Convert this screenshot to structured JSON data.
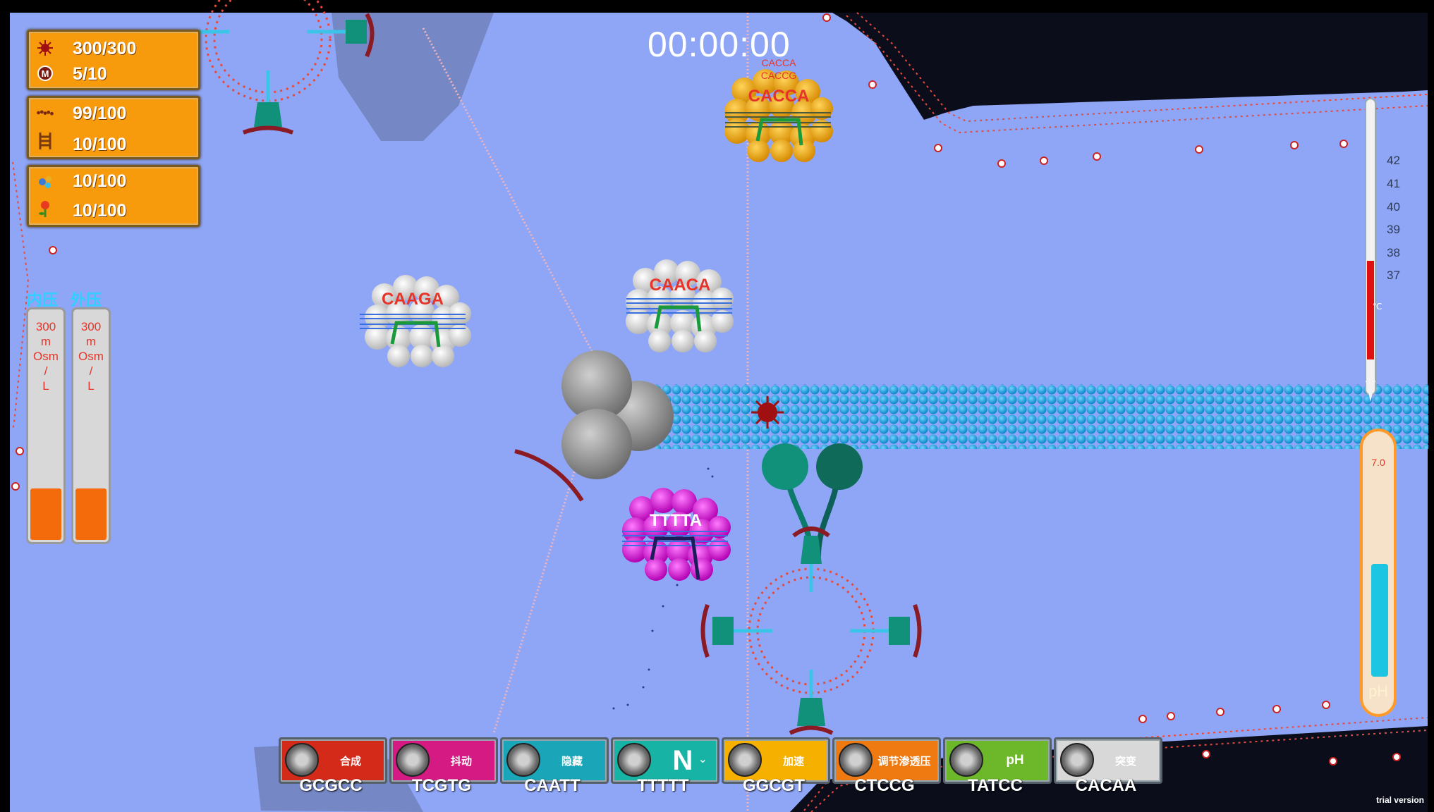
{
  "timer": "00:00:00",
  "resources": [
    {
      "icon": "virus-icon",
      "value": "300/300"
    },
    {
      "icon": "m-coin-icon",
      "value": "5/10"
    },
    {
      "icon": "chain-icon",
      "value": "99/100"
    },
    {
      "icon": "ladder-icon",
      "value": "10/100"
    },
    {
      "icon": "molecule-icon",
      "value": "10/100"
    },
    {
      "icon": "flower-icon",
      "value": "10/100"
    }
  ],
  "pressure": {
    "inner_label": "内压",
    "outer_label": "外压",
    "inner_value": "300\nm\nOsm\n/\nL",
    "outer_value": "300\nm\nOsm\n/\nL",
    "inner_level": 0.22,
    "outer_level": 0.22
  },
  "temperature": {
    "ticks": [
      "42",
      "41",
      "40",
      "39",
      "38",
      "37"
    ],
    "unit": "℃"
  },
  "ph": {
    "value": "7.0",
    "label": "pH",
    "level": 0.45
  },
  "complexes": [
    {
      "label": "CAAGA",
      "color": "white"
    },
    {
      "label": "CAACA",
      "color": "white"
    },
    {
      "label": "CACCA",
      "color": "orange"
    },
    {
      "label": "TTTTA",
      "color": "magenta"
    }
  ],
  "floating_codes": [
    "CACCA",
    "CACCG"
  ],
  "skills": [
    {
      "label": "合成",
      "code": "GCGCC",
      "color": "#d42a1a"
    },
    {
      "label": "抖动",
      "code": "TCGTG",
      "color": "#d61a84"
    },
    {
      "label": "隐藏",
      "code": "CAATT",
      "color": "#1aa6b8"
    },
    {
      "label": "N",
      "code": "TTTTT",
      "color": "#17b3a4"
    },
    {
      "label": "加速",
      "code": "GGCGT",
      "color": "#f6b000"
    },
    {
      "label": "调节渗透压",
      "code": "CTCCG",
      "color": "#f07a12"
    },
    {
      "label": "pH",
      "code": "TATCC",
      "color": "#6cb82a"
    },
    {
      "label": "突变",
      "code": "CACAA",
      "color": "#d8d8d8"
    }
  ],
  "watermark": "trial version"
}
